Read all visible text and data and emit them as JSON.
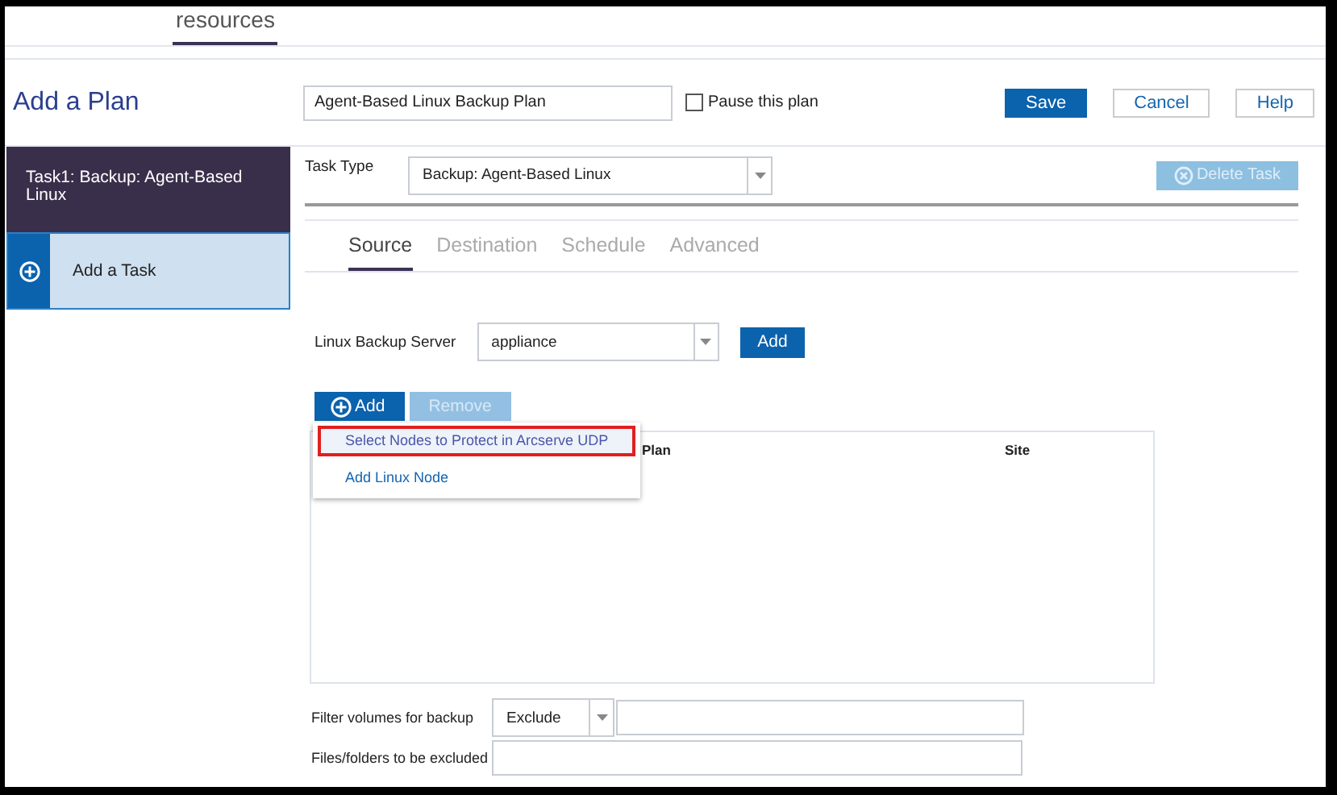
{
  "top_tabs": [
    {
      "label": "resources",
      "selected": true
    }
  ],
  "header": {
    "title": "Add a Plan",
    "plan_name": "Agent-Based Linux Backup Plan",
    "pause": {
      "label": "Pause this plan",
      "checked": false
    },
    "buttons": [
      {
        "label": "Save",
        "kind": "primary"
      },
      {
        "label": "Cancel",
        "kind": "secondary"
      },
      {
        "label": "Help",
        "kind": "secondary"
      }
    ]
  },
  "sidebar": {
    "items": [
      {
        "kind": "task",
        "label": "Task1: Backup: Agent-Based Linux",
        "selected": true
      },
      {
        "kind": "add",
        "label": "Add a Task",
        "selected": false
      }
    ]
  },
  "task_type": {
    "label": "Task Type",
    "value": "Backup: Agent-Based Linux"
  },
  "delete_task": {
    "label": "Delete Task",
    "disabled": true
  },
  "tabs": [
    {
      "label": "Source",
      "selected": true
    },
    {
      "label": "Destination",
      "selected": false
    },
    {
      "label": "Schedule",
      "selected": false
    },
    {
      "label": "Advanced",
      "selected": false
    }
  ],
  "server": {
    "label": "Linux Backup Server",
    "value": "appliance",
    "button": "Add"
  },
  "node_toolbar": [
    {
      "label": "Add",
      "kind": "add",
      "disabled": false
    },
    {
      "label": "Remove",
      "kind": "plain",
      "disabled": true
    }
  ],
  "add_menu": [
    {
      "label": "Select Nodes to Protect in Arcserve UDP",
      "selected": true
    },
    {
      "label": "Add Linux Node",
      "selected": false
    }
  ],
  "table": {
    "columns": [
      "Plan",
      "Site"
    ]
  },
  "filter": {
    "label": "Filter volumes for backup",
    "mode": "Exclude"
  },
  "excluded": {
    "label": "Files/folders to be excluded"
  }
}
